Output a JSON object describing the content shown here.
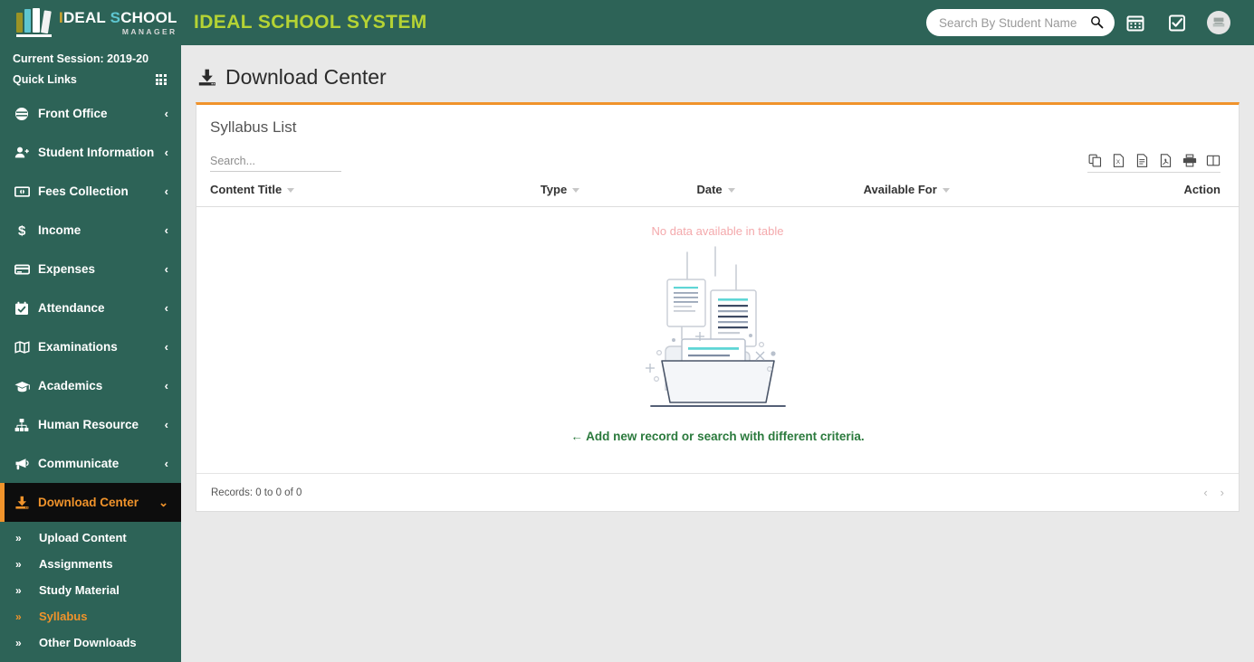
{
  "header": {
    "brand": {
      "line1_i": "I",
      "line1_deal": "DEAL",
      "line1_s": "S",
      "line1_chool": "CHOOL",
      "line2": "MANAGER"
    },
    "system_title": "IDEAL SCHOOL SYSTEM",
    "search_placeholder": "Search By Student Name",
    "search_value": "",
    "icons": [
      "search-icon",
      "calendar-icon",
      "checkbox-icon",
      "avatar-icon"
    ]
  },
  "sidebar": {
    "session": "Current Session: 2019-20",
    "quick_links": "Quick Links",
    "items": [
      {
        "label": "Front Office",
        "icon": "front-office-icon",
        "caret": "‹"
      },
      {
        "label": "Student Information",
        "icon": "student-information-icon",
        "caret": "‹"
      },
      {
        "label": "Fees Collection",
        "icon": "fees-collection-icon",
        "caret": "‹"
      },
      {
        "label": "Income",
        "icon": "income-icon",
        "caret": "‹"
      },
      {
        "label": "Expenses",
        "icon": "expenses-icon",
        "caret": "‹"
      },
      {
        "label": "Attendance",
        "icon": "attendance-icon",
        "caret": "‹"
      },
      {
        "label": "Examinations",
        "icon": "examinations-icon",
        "caret": "‹"
      },
      {
        "label": "Academics",
        "icon": "academics-icon",
        "caret": "‹"
      },
      {
        "label": "Human Resource",
        "icon": "human-resource-icon",
        "caret": "‹"
      },
      {
        "label": "Communicate",
        "icon": "communicate-icon",
        "caret": "‹"
      },
      {
        "label": "Download Center",
        "icon": "download-center-icon",
        "caret": "⌄",
        "active": true
      }
    ],
    "submenu": [
      {
        "label": "Upload Content",
        "active": false
      },
      {
        "label": "Assignments",
        "active": false
      },
      {
        "label": "Study Material",
        "active": false
      },
      {
        "label": "Syllabus",
        "active": true
      },
      {
        "label": "Other Downloads",
        "active": false
      }
    ]
  },
  "main": {
    "page_title": "Download Center",
    "panel_title": "Syllabus List",
    "table_search_placeholder": "Search...",
    "table_search_value": "",
    "export_buttons": [
      {
        "name": "copy-icon",
        "title": "Copy"
      },
      {
        "name": "excel-icon",
        "title": "Excel"
      },
      {
        "name": "csv-icon",
        "title": "CSV"
      },
      {
        "name": "pdf-icon",
        "title": "PDF"
      },
      {
        "name": "print-icon",
        "title": "Print"
      },
      {
        "name": "columns-icon",
        "title": "Column visibility"
      }
    ],
    "columns": [
      {
        "label": "Content Title",
        "sortable": true
      },
      {
        "label": "Type",
        "sortable": true
      },
      {
        "label": "Date",
        "sortable": true
      },
      {
        "label": "Available For",
        "sortable": true
      },
      {
        "label": "Action",
        "sortable": false
      }
    ],
    "rows": [],
    "empty_message": "No data available in table",
    "add_new_text": "Add new record or search with different criteria.",
    "records_text": "Records: 0 to 0 of 0",
    "pager": {
      "prev": "‹",
      "next": "›"
    }
  },
  "colors": {
    "brand_green": "#2d6357",
    "accent_orange": "#f0932b",
    "title_lime": "#b5d334",
    "empty_pink": "#f4a9ac",
    "link_green": "#2b7a3d"
  }
}
